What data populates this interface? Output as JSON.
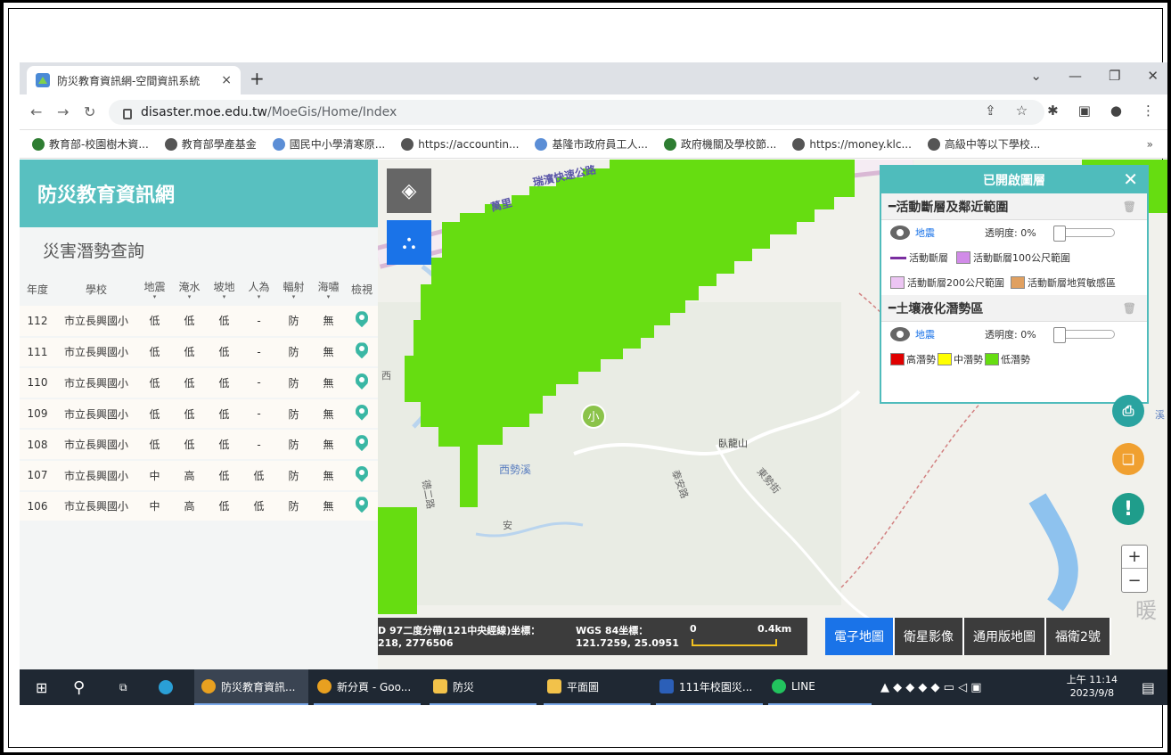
{
  "browser": {
    "tab_title": "防災教育資訊網-空間資訊系統",
    "tab_close": "×",
    "new_tab": "+",
    "url_host": "disaster.moe.edu.tw",
    "url_path": "/MoeGis/Home/Index",
    "bookmarks": [
      "教育部-校園樹木資...",
      "教育部學產基金",
      "國民中小學清寒原...",
      "https://accountin...",
      "基隆市政府員工人...",
      "政府機關及學校節...",
      "https://money.klc...",
      "高級中等以下學校..."
    ],
    "bookmarks_more": "»"
  },
  "sidebar": {
    "title": "防災教育資訊網",
    "subtitle": "災害潛勢查詢",
    "columns": [
      "年度",
      "學校",
      "地震",
      "淹水",
      "坡地",
      "人為",
      "輻射",
      "海嘯",
      "檢視"
    ],
    "rows": [
      [
        "112",
        "市立長興國小",
        "低",
        "低",
        "低",
        "-",
        "防",
        "無"
      ],
      [
        "111",
        "市立長興國小",
        "低",
        "低",
        "低",
        "-",
        "防",
        "無"
      ],
      [
        "110",
        "市立長興國小",
        "低",
        "低",
        "低",
        "-",
        "防",
        "無"
      ],
      [
        "109",
        "市立長興國小",
        "低",
        "低",
        "低",
        "-",
        "防",
        "無"
      ],
      [
        "108",
        "市立長興國小",
        "低",
        "低",
        "低",
        "-",
        "防",
        "無"
      ],
      [
        "107",
        "市立長興國小",
        "中",
        "高",
        "低",
        "低",
        "防",
        "無"
      ],
      [
        "106",
        "市立長興國小",
        "中",
        "高",
        "低",
        "低",
        "防",
        "無"
      ]
    ]
  },
  "map": {
    "labels": {
      "highway": "瑞濱快速公路",
      "wanli": "萬里",
      "mountain": "臥龍山",
      "school_marker": "小",
      "stream": "西勢溪",
      "road_a": "安",
      "road_b": "西",
      "place_right": "溪",
      "place_right2": "暖",
      "road_left": "德二路",
      "road_mid": "東勢街",
      "road_mid2": "泰安路"
    },
    "coords": {
      "twd_label": "D 97二度分帶(121中央經線)坐標：",
      "twd_value": "218, 2776506",
      "wgs_label": "WGS 84坐標：",
      "wgs_value": "121.7259, 25.0951",
      "scale_start": "0",
      "scale_end": "0.4km"
    },
    "basemaps": [
      "電子地圖",
      "衛星影像",
      "通用版地圖",
      "福衛2號"
    ],
    "active_basemap": "電子地圖",
    "zoom_in": "+",
    "zoom_out": "−",
    "alert_icon": "!"
  },
  "layer_panel": {
    "title": "已開啟圖層",
    "close": "✕",
    "sections": [
      {
        "name": "活動斷層及鄰近範圍",
        "layer": "地震",
        "opacity": "透明度: 0%",
        "legend": [
          {
            "label": "活動斷層",
            "color": "#7a2ea0",
            "kind": "line"
          },
          {
            "label": "活動斷層100公尺範圍",
            "color": "#d18be8",
            "kind": "box"
          },
          {
            "label": "活動斷層200公尺範圍",
            "color": "#ecc5f3",
            "kind": "box"
          },
          {
            "label": "活動斷層地質敏感區",
            "color": "#e0a060",
            "kind": "box"
          }
        ]
      },
      {
        "name": "土壤液化潛勢區",
        "layer": "地震",
        "opacity": "透明度: 0%",
        "legend": [
          {
            "label": "高潛勢",
            "color": "#e00000",
            "kind": "box"
          },
          {
            "label": "中潛勢",
            "color": "#ffff00",
            "kind": "box"
          },
          {
            "label": "低潛勢",
            "color": "#66dd11",
            "kind": "box"
          }
        ]
      }
    ]
  },
  "taskbar": {
    "items": [
      "防災教育資訊...",
      "新分頁 - Goo...",
      "防災",
      "平面圖",
      "111年校園災...",
      "LINE"
    ],
    "time": "上午 11:14",
    "date": "2023/9/8"
  },
  "colors": {
    "accent": "#58c0c0",
    "liquefaction_low": "#66dd11",
    "active_button": "#1a73e8"
  }
}
